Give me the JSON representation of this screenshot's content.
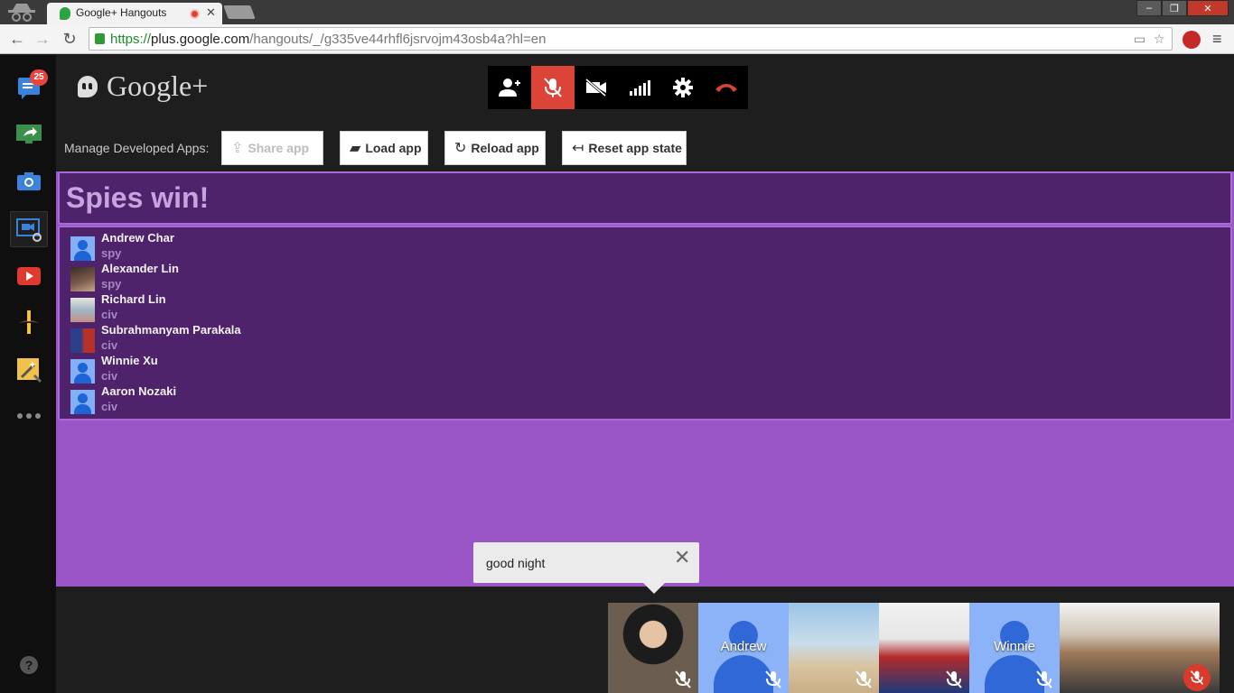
{
  "browser": {
    "tab_title": "Google+ Hangouts",
    "url_scheme": "https://",
    "url_host": "plus.google.com",
    "url_path": "/hangouts/_/g335ve44rhfl6jsrvojm43osb4a?hl=en"
  },
  "rail": {
    "notification_count": "25",
    "help_label": "?"
  },
  "header": {
    "logo_text": "Google+"
  },
  "call_controls": [
    "add-people",
    "mute-mic",
    "turn-off-camera",
    "bandwidth",
    "settings",
    "hang-up"
  ],
  "dev_apps": {
    "label": "Manage Developed Apps:",
    "share_label": "Share app",
    "load_label": "Load app",
    "reload_label": "Reload app",
    "reset_label": "Reset app state"
  },
  "game": {
    "result": "Spies win!",
    "players": [
      {
        "name": "Andrew Char",
        "role": "spy"
      },
      {
        "name": "Alexander Lin",
        "role": "spy"
      },
      {
        "name": "Richard Lin",
        "role": "civ"
      },
      {
        "name": "Subrahmanyam Parakala",
        "role": "civ"
      },
      {
        "name": "Winnie Xu",
        "role": "civ"
      },
      {
        "name": "Aaron Nozaki",
        "role": "civ"
      }
    ]
  },
  "toast": {
    "message": "good night"
  },
  "filmstrip": {
    "tiles": [
      {
        "name": ""
      },
      {
        "name": "Andrew"
      },
      {
        "name": ""
      },
      {
        "name": ""
      },
      {
        "name": "Winnie"
      },
      {
        "name": ""
      }
    ]
  },
  "colors": {
    "accent_red": "#db4437",
    "app_purple": "#9a55c6",
    "panel_purple": "#4f236b"
  }
}
